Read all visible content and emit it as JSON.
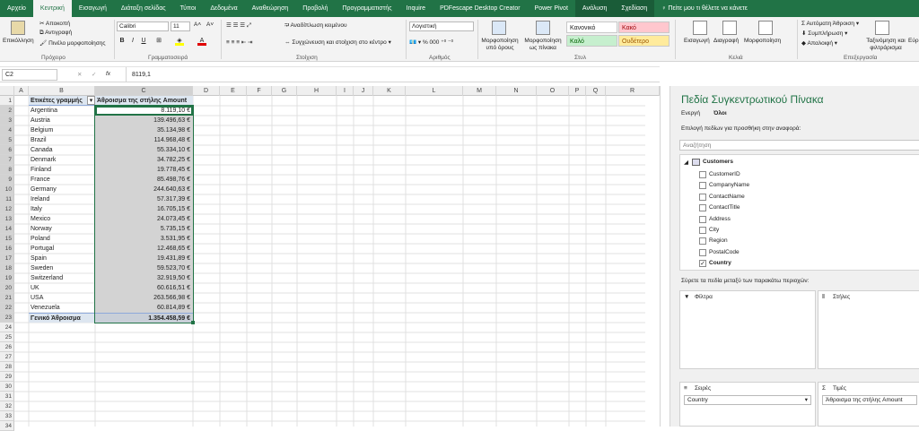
{
  "tabs": [
    "Αρχείο",
    "Κεντρική",
    "Εισαγωγή",
    "Διάταξη σελίδας",
    "Τύποι",
    "Δεδομένα",
    "Αναθεώρηση",
    "Προβολή",
    "Προγραμματιστής",
    "Inquire",
    "PDFescape Desktop Creator",
    "Power Pivot",
    "Ανάλυση",
    "Σχεδίαση"
  ],
  "tell_me": "Πείτε μου τι θέλετε να κάνετε",
  "ribbon": {
    "paste": "Επικόλληση",
    "cut": "Αποκοπή",
    "copy": "Αντιγραφή",
    "format_painter": "Πινέλο μορφοποίησης",
    "clipboard": "Πρόχειρο",
    "font_name": "Calibri",
    "font_size": "11",
    "font_group": "Γραμματοσειρά",
    "wrap_text": "Αναδίπλωση κειμένου",
    "merge_center": "Συγχώνευση και στοίχιση στο κέντρο",
    "alignment": "Στοίχιση",
    "number_format": "Λογιστική",
    "number": "Αριθμός",
    "cond_format": "Μορφοποίηση υπό όρους",
    "format_table": "Μορφοποίηση ως πίνακα",
    "styles": "Στυλ",
    "style_normal": "Κανονικό",
    "style_bad": "Κακό",
    "style_good": "Καλό",
    "style_neutral": "Ουδέτερο",
    "insert": "Εισαγωγή",
    "delete": "Διαγραφή",
    "format": "Μορφοποίηση",
    "cells": "Κελιά",
    "autosum": "Αυτόματη Άθροιση",
    "fill": "Συμπλήρωση",
    "clear": "Απαλοιφή",
    "sort_filter": "Ταξινόμηση και φιλτράρισμα",
    "find_select": "Εύρ",
    "editing": "Επεξεργασία"
  },
  "formula_bar": {
    "name_box": "C2",
    "fx": "fx",
    "value": "8119,1"
  },
  "columns": [
    "A",
    "B",
    "C",
    "D",
    "E",
    "F",
    "G",
    "H",
    "I",
    "J",
    "K",
    "L",
    "M",
    "N",
    "O",
    "P",
    "Q",
    "R"
  ],
  "sheet": {
    "header_label": "Ετικέτες γραμμής",
    "header_value": "Άθροισμα της στήλης Amount",
    "rows": [
      {
        "country": "Argentina",
        "amount": "8.119,10 €"
      },
      {
        "country": "Austria",
        "amount": "139.496,63 €"
      },
      {
        "country": "Belgium",
        "amount": "35.134,98 €"
      },
      {
        "country": "Brazil",
        "amount": "114.968,48 €"
      },
      {
        "country": "Canada",
        "amount": "55.334,10 €"
      },
      {
        "country": "Denmark",
        "amount": "34.782,25 €"
      },
      {
        "country": "Finland",
        "amount": "19.778,45 €"
      },
      {
        "country": "France",
        "amount": "85.498,76 €"
      },
      {
        "country": "Germany",
        "amount": "244.640,63 €"
      },
      {
        "country": "Ireland",
        "amount": "57.317,39 €"
      },
      {
        "country": "Italy",
        "amount": "16.705,15 €"
      },
      {
        "country": "Mexico",
        "amount": "24.073,45 €"
      },
      {
        "country": "Norway",
        "amount": "5.735,15 €"
      },
      {
        "country": "Poland",
        "amount": "3.531,95 €"
      },
      {
        "country": "Portugal",
        "amount": "12.468,65 €"
      },
      {
        "country": "Spain",
        "amount": "19.431,89 €"
      },
      {
        "country": "Sweden",
        "amount": "59.523,70 €"
      },
      {
        "country": "Switzerland",
        "amount": "32.919,50 €"
      },
      {
        "country": "UK",
        "amount": "60.616,51 €"
      },
      {
        "country": "USA",
        "amount": "263.566,98 €"
      },
      {
        "country": "Venezuela",
        "amount": "60.814,89 €"
      }
    ],
    "total_label": "Γενικό Άθροισμα",
    "total_value": "1.354.458,59 €",
    "row_numbers": [
      "1",
      "2",
      "3",
      "4",
      "5",
      "6",
      "7",
      "8",
      "9",
      "10",
      "11",
      "12",
      "13",
      "14",
      "15",
      "16",
      "17",
      "18",
      "19",
      "20",
      "21",
      "22",
      "23",
      "24",
      "25",
      "26",
      "27",
      "28",
      "29",
      "30",
      "31",
      "32",
      "33",
      "34"
    ]
  },
  "pivot_pane": {
    "title": "Πεδία Συγκεντρωτικού Πίνακα",
    "tab_active": "Ενεργή",
    "tab_all": "Όλοι",
    "choose": "Επιλογή πεδίων για προσθήκη στην αναφορά:",
    "search_placeholder": "Αναζήτηση",
    "table": "Customers",
    "fields": [
      {
        "name": "CustomerID",
        "checked": false
      },
      {
        "name": "CompanyName",
        "checked": false
      },
      {
        "name": "ContactName",
        "checked": false
      },
      {
        "name": "ContactTitle",
        "checked": false
      },
      {
        "name": "Address",
        "checked": false
      },
      {
        "name": "City",
        "checked": false
      },
      {
        "name": "Region",
        "checked": false
      },
      {
        "name": "PostalCode",
        "checked": false
      },
      {
        "name": "Country",
        "checked": true
      }
    ],
    "drag_hint": "Σύρετε τα πεδία μεταξύ των παρακάτω περιοχών:",
    "filters": "Φίλτρα",
    "columns": "Στήλες",
    "rows": "Σειρές",
    "values": "Τιμές",
    "rows_item": "Country",
    "values_item": "Άθροισμα της στήλης Amount"
  },
  "colors": {
    "excel_green": "#217346",
    "selection": "#d3d3d3",
    "pivot_header": "#dde6f0",
    "style_bad": "#ffc7ce",
    "style_good": "#c6efce",
    "style_neutral": "#ffeb9c"
  }
}
